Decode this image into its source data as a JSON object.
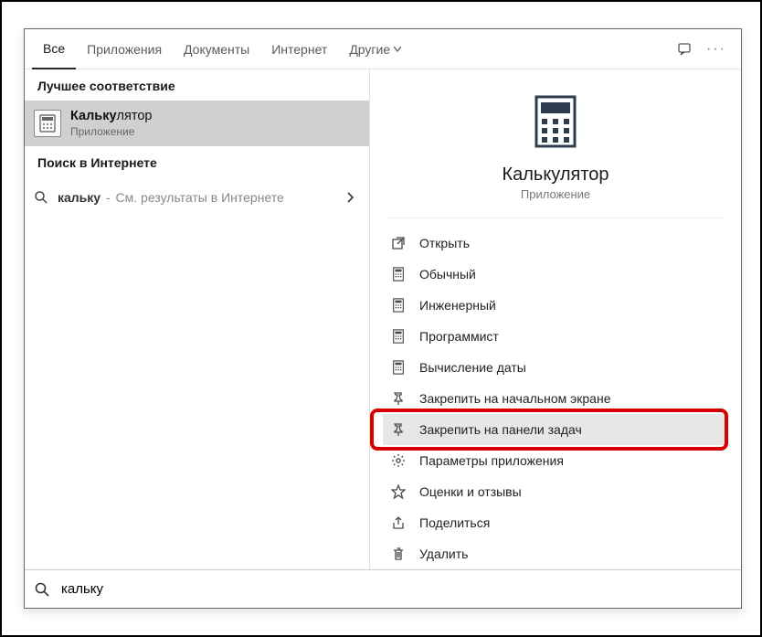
{
  "tabs": {
    "all": "Все",
    "apps": "Приложения",
    "docs": "Документы",
    "web": "Интернет",
    "more": "Другие"
  },
  "left": {
    "best_match_header": "Лучшее соответствие",
    "result": {
      "title_bold": "Кальку",
      "title_rest": "лятор",
      "subtitle": "Приложение"
    },
    "web_header": "Поиск в Интернете",
    "web_row": {
      "query": "кальку",
      "suffix": "См. результаты в Интернете"
    }
  },
  "right": {
    "title": "Калькулятор",
    "subtitle": "Приложение",
    "actions": [
      {
        "id": "open",
        "label": "Открыть",
        "icon": "open"
      },
      {
        "id": "standard",
        "label": "Обычный",
        "icon": "calc"
      },
      {
        "id": "scientific",
        "label": "Инженерный",
        "icon": "calc"
      },
      {
        "id": "programmer",
        "label": "Программист",
        "icon": "calc"
      },
      {
        "id": "date",
        "label": "Вычисление даты",
        "icon": "calc"
      },
      {
        "id": "pin-start",
        "label": "Закрепить на начальном экране",
        "icon": "pin"
      },
      {
        "id": "pin-taskbar",
        "label": "Закрепить на панели задач",
        "icon": "pin",
        "hover": true,
        "highlight": true
      },
      {
        "id": "app-settings",
        "label": "Параметры приложения",
        "icon": "gear"
      },
      {
        "id": "reviews",
        "label": "Оценки и отзывы",
        "icon": "star"
      },
      {
        "id": "share",
        "label": "Поделиться",
        "icon": "share"
      },
      {
        "id": "uninstall",
        "label": "Удалить",
        "icon": "trash"
      }
    ]
  },
  "search": {
    "query": "кальку"
  }
}
